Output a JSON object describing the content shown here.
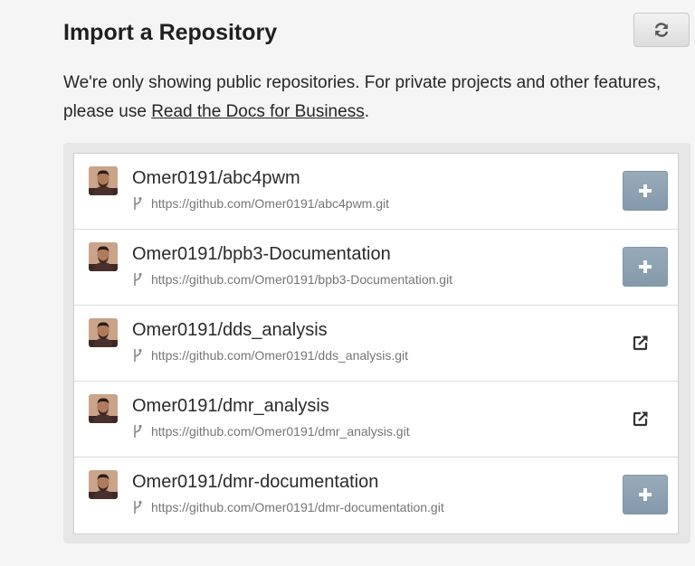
{
  "header": {
    "title": "Import a Repository"
  },
  "intro": {
    "text": "We're only showing public repositories. For private projects and other features, please use ",
    "link_label": "Read the Docs for Business",
    "suffix": "."
  },
  "colors": {
    "add_button": "#8a9eae",
    "link": "#262626",
    "panel_bg": "#e6e6e6"
  },
  "icons": {
    "refresh": "refresh-icon",
    "add": "plus-icon",
    "external": "external-link-icon",
    "branch": "branch-icon"
  },
  "repositories": [
    {
      "name": "Omer0191/abc4pwm",
      "url": "https://github.com/Omer0191/abc4pwm.git",
      "action": "add"
    },
    {
      "name": "Omer0191/bpb3-Documentation",
      "url": "https://github.com/Omer0191/bpb3-Documentation.git",
      "action": "add"
    },
    {
      "name": "Omer0191/dds_analysis",
      "url": "https://github.com/Omer0191/dds_analysis.git",
      "action": "external"
    },
    {
      "name": "Omer0191/dmr_analysis",
      "url": "https://github.com/Omer0191/dmr_analysis.git",
      "action": "external"
    },
    {
      "name": "Omer0191/dmr-documentation",
      "url": "https://github.com/Omer0191/dmr-documentation.git",
      "action": "add"
    }
  ]
}
